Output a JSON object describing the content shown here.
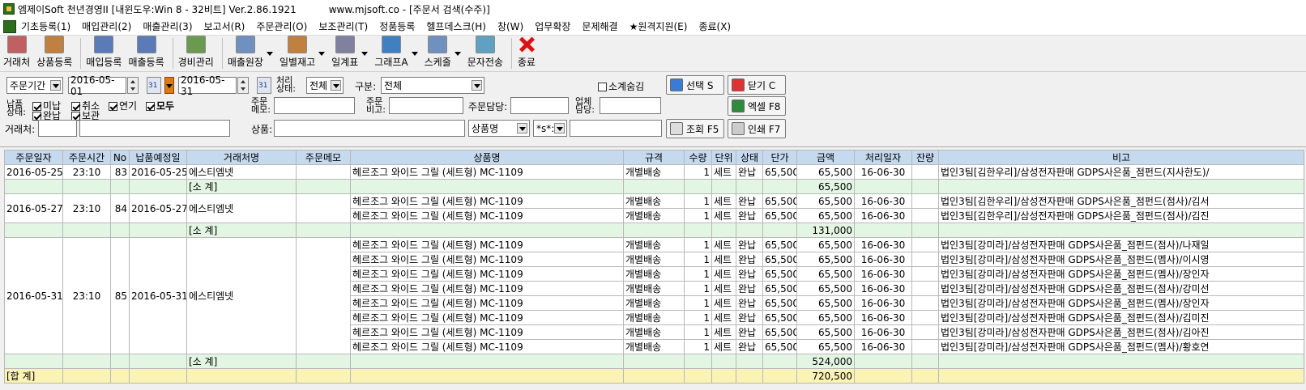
{
  "window": {
    "title": "엠제이Soft 천년경영II [내윈도우:Win 8 - 32비트] Ver.2.86.1921",
    "url_title": "www.mjsoft.co - [주문서 검색(수주)]"
  },
  "menu": [
    "기초등록(1)",
    "매입관리(2)",
    "매출관리(3)",
    "보고서(R)",
    "주문관리(O)",
    "보조관리(T)",
    "정품등록",
    "헬프데스크(H)",
    "창(W)",
    "업무확장",
    "문제해결",
    "★원격지원(E)",
    "종료(X)"
  ],
  "toolbar": [
    {
      "label": "거래처",
      "icon": "customer-icon",
      "color": "#c06060"
    },
    {
      "label": "상품등록",
      "icon": "product-box-icon",
      "color": "#c08040"
    },
    {
      "label": "매입등록",
      "icon": "purchase-icon",
      "color": "#5a7ab8"
    },
    {
      "label": "매출등록",
      "icon": "sales-icon",
      "color": "#5a7ab8"
    },
    {
      "label": "경비관리",
      "icon": "expense-icon",
      "color": "#6a9a50"
    },
    {
      "label": "매출원장",
      "icon": "ledger-icon",
      "color": "#7090c0"
    },
    {
      "label": "일별재고",
      "icon": "daily-stock-icon",
      "color": "#c08040"
    },
    {
      "label": "일계표",
      "icon": "daily-sheet-icon",
      "color": "#8080a0"
    },
    {
      "label": "그래프A",
      "icon": "graph-icon",
      "color": "#4080c0"
    },
    {
      "label": "스케줄",
      "icon": "schedule-icon",
      "color": "#7090c0"
    },
    {
      "label": "문자전송",
      "icon": "sms-icon",
      "color": "#60a0c0"
    },
    {
      "label": "종료",
      "icon": "exit-icon",
      "color": "#d11"
    }
  ],
  "filters": {
    "period_select": "주문기간",
    "date_from": "2016-05-01",
    "date_to": "2016-05-31",
    "process_label": "처리\n상태:",
    "process_value": "전체",
    "type_label": "구분:",
    "type_value": "전체",
    "subtotal_hide": "소계숨김",
    "select_btn": "선택 S",
    "close_btn": "닫기 C",
    "delivery_label": "납품\n상태:",
    "chk": {
      "unpaid": "미납",
      "cancel": "취소",
      "delay": "연기",
      "all": "모두",
      "done": "완납",
      "hold": "보관"
    },
    "order_memo_label": "주문\n메모:",
    "order_note_label": "주문\n비고:",
    "order_manager_label": "주문담당:",
    "biz_manager_label": "업체\n담당:",
    "excel_btn": "엑셀 F8",
    "client_label": "거래처:",
    "product_label": "상품:",
    "product_field": "상품명",
    "match_select": "*s*:",
    "search_btn": "조회 F5",
    "print_btn": "인쇄 F7"
  },
  "columns": [
    "주문일자",
    "주문시간",
    "No",
    "납품예정일",
    "거래처명",
    "주문메모",
    "상품명",
    "규격",
    "수량",
    "단위",
    "상태",
    "단가",
    "금액",
    "처리일자",
    "잔량",
    "비고"
  ],
  "groups": [
    {
      "date": "2016-05-25",
      "time": "23:10",
      "no": "83",
      "due": "2016-05-25",
      "client": "에스티엠넷",
      "subtotal_label": "[소 계]",
      "subtotal": "65,500",
      "rows": [
        [
          "헤르조그 와이드 그릴 (세트형) MC-1109",
          "개별배송",
          "1",
          "세트",
          "완납",
          "65,500",
          "65,500",
          "16-06-30",
          "",
          "법인3팀[김한우리]/삼성전자판매 GDPS사은품_점펀드(지사한도)/"
        ]
      ]
    },
    {
      "date": "2016-05-27",
      "time": "23:10",
      "no": "84",
      "due": "2016-05-27",
      "client": "에스티엠넷",
      "subtotal_label": "[소 계]",
      "subtotal": "131,000",
      "rows": [
        [
          "헤르조그 와이드 그릴 (세트형) MC-1109",
          "개별배송",
          "1",
          "세트",
          "완납",
          "65,500",
          "65,500",
          "16-06-30",
          "",
          "법인3팀[김한우리]/삼성전자판매 GDPS사은품_점펀드(점사)/김서"
        ],
        [
          "헤르조그 와이드 그릴 (세트형) MC-1109",
          "개별배송",
          "1",
          "세트",
          "완납",
          "65,500",
          "65,500",
          "16-06-30",
          "",
          "법인3팀[김한우리]/삼성전자판매 GDPS사은품_점펀드(점사)/김진"
        ]
      ]
    },
    {
      "date": "2016-05-31",
      "time": "23:10",
      "no": "85",
      "due": "2016-05-31",
      "client": "에스티엠넷",
      "subtotal_label": "[소 계]",
      "subtotal": "524,000",
      "rows": [
        [
          "헤르조그 와이드 그릴 (세트형) MC-1109",
          "개별배송",
          "1",
          "세트",
          "완납",
          "65,500",
          "65,500",
          "16-06-30",
          "",
          "법인3팀[강미라]/삼성전자판매 GDPS사은품_점펀드(점사)/나재일"
        ],
        [
          "헤르조그 와이드 그릴 (세트형) MC-1109",
          "개별배송",
          "1",
          "세트",
          "완납",
          "65,500",
          "65,500",
          "16-06-30",
          "",
          "법인3팀[강미라]/삼성전자판매 GDPS사은품_점펀드(멤사)/이시영"
        ],
        [
          "헤르조그 와이드 그릴 (세트형) MC-1109",
          "개별배송",
          "1",
          "세트",
          "완납",
          "65,500",
          "65,500",
          "16-06-30",
          "",
          "법인3팀[강미라]/삼성전자판매 GDPS사은품_점펀드(멤사)/장인자"
        ],
        [
          "헤르조그 와이드 그릴 (세트형) MC-1109",
          "개별배송",
          "1",
          "세트",
          "완납",
          "65,500",
          "65,500",
          "16-06-30",
          "",
          "법인3팀[강미라]/삼성전자판매 GDPS사은품_점펀드(점사)/강미선"
        ],
        [
          "헤르조그 와이드 그릴 (세트형) MC-1109",
          "개별배송",
          "1",
          "세트",
          "완납",
          "65,500",
          "65,500",
          "16-06-30",
          "",
          "법인3팀[강미라]/삼성전자판매 GDPS사은품_점펀드(멤사)/장인자"
        ],
        [
          "헤르조그 와이드 그릴 (세트형) MC-1109",
          "개별배송",
          "1",
          "세트",
          "완납",
          "65,500",
          "65,500",
          "16-06-30",
          "",
          "법인3팀[강미라]/삼성전자판매 GDPS사은품_점펀드(점사)/김미진"
        ],
        [
          "헤르조그 와이드 그릴 (세트형) MC-1109",
          "개별배송",
          "1",
          "세트",
          "완납",
          "65,500",
          "65,500",
          "16-06-30",
          "",
          "법인3팀[강미라]/삼성전자판매 GDPS사은품_점펀드(점사)/김아진"
        ],
        [
          "헤르조그 와이드 그릴 (세트형) MC-1109",
          "개별배송",
          "1",
          "세트",
          "완납",
          "65,500",
          "65,500",
          "16-06-30",
          "",
          "법인3팀[강미라]/삼성전자판매 GDPS사은품_점펀드(멤사)/황호연"
        ]
      ]
    }
  ],
  "total": {
    "label": "[합 계]",
    "amount": "720,500"
  }
}
